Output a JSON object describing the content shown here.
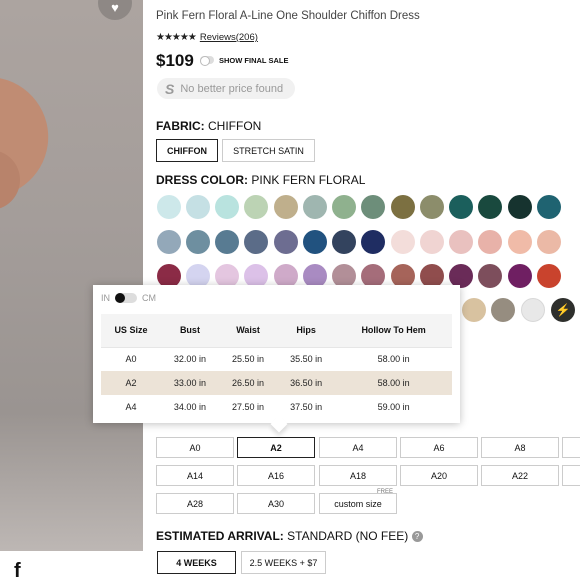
{
  "product": {
    "title": "Pink Fern Floral A-Line One Shoulder Chiffon Dress",
    "stars": "★★★★★",
    "reviews": "Reviews(206)",
    "price": "$109",
    "show_final_sale": "SHOW FINAL SALE",
    "no_better_price_icon": "S",
    "no_better_price": "No better price found"
  },
  "fabric": {
    "label": "FABRIC:",
    "value": "CHIFFON",
    "options": [
      "CHIFFON",
      "STRETCH SATIN"
    ],
    "selected": "CHIFFON"
  },
  "color": {
    "label": "DRESS COLOR:",
    "value": "PINK FERN FLORAL",
    "swatches": [
      "#cde8ea",
      "#c5e0e4",
      "#b9e3df",
      "#bcd3b4",
      "#bfaf8c",
      "#9fb6b0",
      "#8fb18e",
      "#6d8e7a",
      "#7c7041",
      "#8c8d6b",
      "#1b5f5c",
      "#19493e",
      "#16332f",
      "#1f6371",
      "#93a8b9",
      "#6e8fa0",
      "#587b92",
      "#5b6c88",
      "#6d6d91",
      "#21527f",
      "#33435e",
      "#1f2d62",
      "#f3ddda",
      "#f0d4d2",
      "#e9c1bf",
      "#e8b2a9",
      "#f0bba8",
      "#ebb9a6",
      "#8b2b46",
      "#d4d4f0",
      "#e4c6e0",
      "#dcc1e8",
      "#cfaac9",
      "#a98bc2",
      "#b28f98",
      "#a56d7a",
      "#a6645a",
      "#904d4d",
      "#6a2b58",
      "#7d4e5c",
      "#6f1f62",
      "#c9432d",
      "#d8c2a0",
      "#968d80",
      "#e8e8e8",
      "#2e2f2c"
    ],
    "bolt_icon": "⚡"
  },
  "size_chart": {
    "unit_in": "IN",
    "unit_cm": "CM",
    "headers": [
      "US Size",
      "Bust",
      "Waist",
      "Hips",
      "Hollow To Hem"
    ],
    "rows": [
      [
        "A0",
        "32.00 in",
        "25.50 in",
        "35.50 in",
        "58.00 in"
      ],
      [
        "A2",
        "33.00 in",
        "26.50 in",
        "36.50 in",
        "58.00 in"
      ],
      [
        "A4",
        "34.00 in",
        "27.50 in",
        "37.50 in",
        "59.00 in"
      ]
    ],
    "highlighted_row": 1
  },
  "sizes": {
    "options": [
      "A0",
      "A2",
      "A4",
      "A6",
      "A8",
      "A14",
      "A16",
      "A18",
      "A20",
      "A22",
      "A28",
      "A30",
      "custom size"
    ],
    "selected": "A2",
    "free_badge": "FREE"
  },
  "arrival": {
    "label": "ESTIMATED ARRIVAL:",
    "value": "STANDARD (NO FEE)",
    "help_icon": "?",
    "options": [
      "4 WEEKS",
      "2.5 WEEKS + $7"
    ],
    "selected": "4 WEEKS"
  },
  "social": {
    "facebook": "f"
  }
}
